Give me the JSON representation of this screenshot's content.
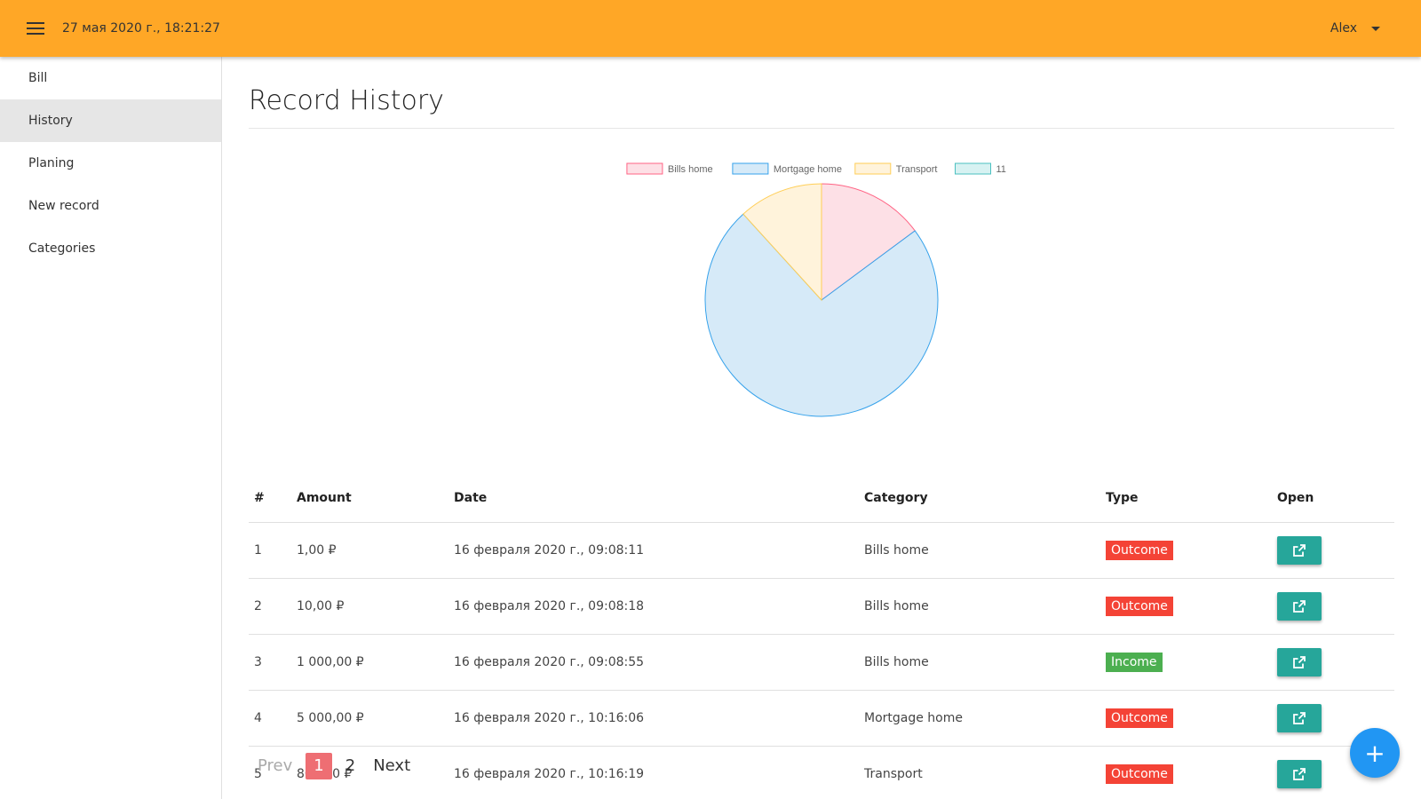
{
  "header": {
    "datetime": "27 мая 2020 г., 18:21:27",
    "user": "Alex",
    "menu_icon": "hamburger-icon",
    "caret_icon": "caret-down-icon"
  },
  "sidebar": {
    "items": [
      {
        "label": "Bill",
        "active": false
      },
      {
        "label": "History",
        "active": true
      },
      {
        "label": "Planing",
        "active": false
      },
      {
        "label": "New record",
        "active": false
      },
      {
        "label": "Categories",
        "active": false
      }
    ]
  },
  "page": {
    "title": "Record History"
  },
  "chart_data": {
    "type": "pie",
    "labels": [
      "Bills home",
      "Mortgage home",
      "Transport",
      "11"
    ],
    "values": [
      1011,
      5000,
      800,
      0
    ],
    "colors": {
      "fill": [
        "#FDE0E6",
        "#D6EAF8",
        "#FFF3DB",
        "#D7F2F2"
      ],
      "stroke": [
        "#FF6384",
        "#36A2EB",
        "#FFCE56",
        "#4BC0C0"
      ]
    },
    "legend": "top"
  },
  "table": {
    "headers": [
      "#",
      "Amount",
      "Date",
      "Category",
      "Type",
      "Open"
    ],
    "rows": [
      {
        "n": "1",
        "amount": "1,00 ₽",
        "date": "16 февраля 2020 г., 09:08:11",
        "category": "Bills home",
        "type": "Outcome"
      },
      {
        "n": "2",
        "amount": "10,00 ₽",
        "date": "16 февраля 2020 г., 09:08:18",
        "category": "Bills home",
        "type": "Outcome"
      },
      {
        "n": "3",
        "amount": "1 000,00 ₽",
        "date": "16 февраля 2020 г., 09:08:55",
        "category": "Bills home",
        "type": "Income"
      },
      {
        "n": "4",
        "amount": "5 000,00 ₽",
        "date": "16 февраля 2020 г., 10:16:06",
        "category": "Mortgage home",
        "type": "Outcome"
      },
      {
        "n": "5",
        "amount": "800,00 ₽",
        "date": "16 февраля 2020 г., 10:16:19",
        "category": "Transport",
        "type": "Outcome"
      }
    ],
    "type_colors": {
      "Outcome": "#F44336",
      "Income": "#4CAF50"
    },
    "open_icon": "external-link-icon"
  },
  "pagination": {
    "prev": "Prev",
    "pages": [
      "1",
      "2"
    ],
    "current": "1",
    "next": "Next"
  },
  "fab": {
    "label": "+",
    "icon": "plus-icon"
  }
}
